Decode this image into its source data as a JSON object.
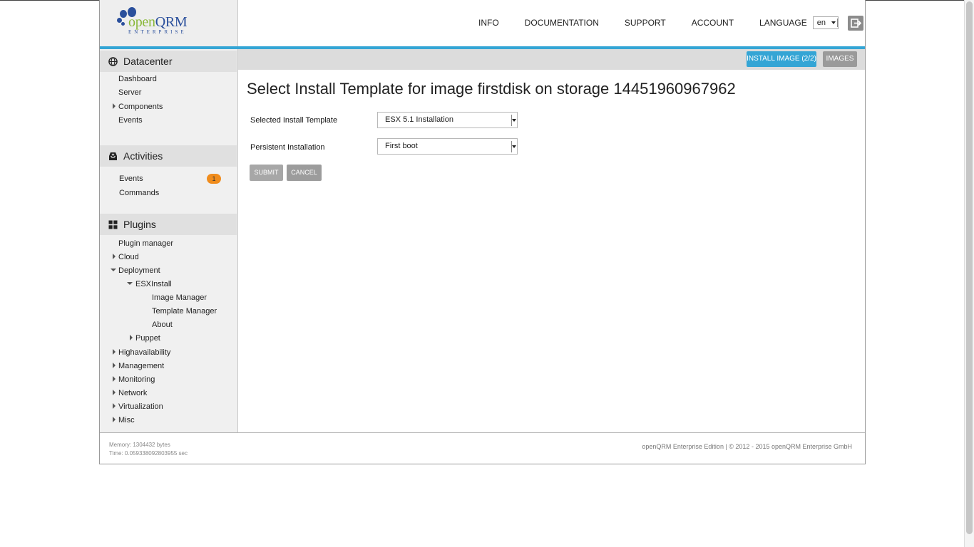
{
  "brand": {
    "name_prefix": "open",
    "name_main": "QRM",
    "subtitle": "ENTERPRISE"
  },
  "topnav": {
    "links": [
      "INFO",
      "DOCUMENTATION",
      "SUPPORT",
      "ACCOUNT"
    ],
    "language_label": "LANGUAGE",
    "language_value": "en"
  },
  "actions": {
    "install_image": "INSTALL IMAGE (2/2)",
    "images": "IMAGES"
  },
  "sidebar": {
    "datacenter": {
      "title": "Datacenter",
      "items": [
        "Dashboard",
        "Server",
        "Components",
        "Events"
      ]
    },
    "activities": {
      "title": "Activities",
      "items": [
        "Events",
        "Commands"
      ],
      "events_badge": "1"
    },
    "plugins": {
      "title": "Plugins",
      "items": [
        "Plugin manager",
        "Cloud",
        "Deployment",
        "ESXInstall",
        "Image Manager",
        "Template Manager",
        "About",
        "Puppet",
        "Highavailability",
        "Management",
        "Monitoring",
        "Network",
        "Virtualization",
        "Misc"
      ]
    }
  },
  "main": {
    "title": "Select Install Template for image firstdisk on storage 14451960967962",
    "fields": [
      {
        "label": "Selected Install Template",
        "value": "ESX 5.1 Installation"
      },
      {
        "label": "Persistent Installation",
        "value": "First boot"
      }
    ],
    "submit": "SUBMIT",
    "cancel": "CANCEL"
  },
  "footer": {
    "memory": "Memory: 1304432 bytes",
    "time": "Time: 0.059338092803955 sec",
    "copyright": "openQRM Enterprise Edition | © 2012 - 2015 openQRM Enterprise GmbH"
  },
  "colors": {
    "accent": "#34a5d5",
    "badge": "#f08c1c",
    "button": "#a7a7a7",
    "brand_blue": "#2a4f9c",
    "brand_green": "#8ab83a"
  },
  "icons": {
    "datacenter": "globe-icon",
    "activities": "inbox-icon",
    "plugins": "grid-icon",
    "logout": "logout-icon"
  }
}
